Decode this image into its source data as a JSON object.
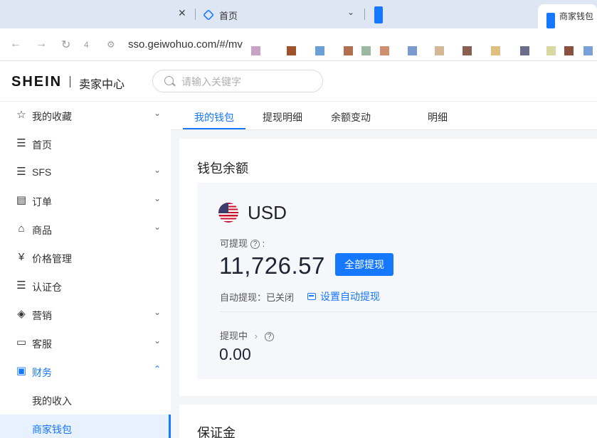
{
  "browser": {
    "tabs": [
      {
        "label": ""
      },
      {
        "label": "首页"
      },
      {
        "label": ""
      },
      {
        "label": "商家钱包"
      }
    ],
    "url": "sso.geiwohuo.com/#/mv",
    "nav_extra": "4",
    "pixel_colors": [
      "#c9a3c6",
      "#a0522d",
      "#6a9fd8",
      "#b07050",
      "#9db8a0",
      "#d09070",
      "#7a9bd0",
      "#d4b896",
      "#8a6050",
      "#e0c080",
      "#6b6b8a",
      "#d8d8a0",
      "#8a5040",
      "#7aa0d8"
    ]
  },
  "header": {
    "logo": "SHEIN",
    "subtitle": "卖家中心",
    "search_placeholder": "请输入关键字"
  },
  "sidebar": {
    "items": [
      {
        "label": "我的收藏",
        "icon": "☆",
        "chevron": "⌄"
      },
      {
        "label": "首页",
        "icon": "☰",
        "chevron": ""
      },
      {
        "label": "SFS",
        "icon": "☰",
        "chevron": "⌄"
      },
      {
        "label": "订单",
        "icon": "▤",
        "chevron": "⌄"
      },
      {
        "label": "商品",
        "icon": "⌂",
        "chevron": "⌄"
      },
      {
        "label": "价格管理",
        "icon": "¥",
        "chevron": ""
      },
      {
        "label": "认证仓",
        "icon": "☰",
        "chevron": ""
      },
      {
        "label": "营销",
        "icon": "◈",
        "chevron": "⌄"
      },
      {
        "label": "客服",
        "icon": "▭",
        "chevron": "⌄"
      },
      {
        "label": "财务",
        "icon": "▣",
        "chevron": "⌃"
      }
    ],
    "sub_items": [
      {
        "label": "我的收入"
      },
      {
        "label": "商家钱包"
      }
    ]
  },
  "main": {
    "tabs": [
      "我的钱包",
      "提现明细",
      "余额变动",
      "明细"
    ],
    "wallet": {
      "title": "钱包余额",
      "currency": "USD",
      "available_label": "可提现",
      "colon": ":",
      "amount": "11,726.57",
      "withdraw_all": "全部提现",
      "auto_withdraw_label": "自动提现：已关闭",
      "set_auto_withdraw": "设置自动提现",
      "pending_label": "提现中",
      "pending_arrow": "›",
      "pending_amount": "0.00"
    },
    "deposit_title": "保证金"
  },
  "colors": {
    "accent": "#1677ff"
  }
}
